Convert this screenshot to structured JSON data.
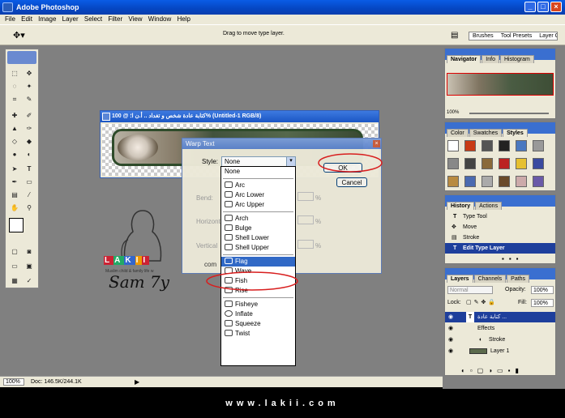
{
  "app": {
    "title": "Adobe Photoshop",
    "menu": [
      "File",
      "Edit",
      "Image",
      "Layer",
      "Select",
      "Filter",
      "View",
      "Window",
      "Help"
    ],
    "window_buttons": {
      "minimize": "_",
      "maximize": "□",
      "close": "×"
    }
  },
  "options_bar": {
    "hint": "Drag to move type layer.",
    "palette_tabs": [
      "Brushes",
      "Tool Presets",
      "Layer Comps"
    ]
  },
  "document": {
    "title": "كتابة عادة شخص و تغداد .. أ.ن ا؛ @ 100% (Untitled-1 RGB/8)"
  },
  "status": {
    "zoom": "100%",
    "doc": "Doc: 146.5K/244.1K"
  },
  "navigator": {
    "tabs": [
      "Navigator",
      "Info",
      "Histogram"
    ],
    "zoom": "100%"
  },
  "styles_panel": {
    "tabs": [
      "Color",
      "Swatches",
      "Styles"
    ]
  },
  "history_panel": {
    "tabs": [
      "History",
      "Actions"
    ],
    "items": [
      "Type Tool",
      "Move",
      "Stroke",
      "Edit Type Layer"
    ]
  },
  "layers_panel": {
    "tabs": [
      "Layers",
      "Channels",
      "Paths"
    ],
    "blend_mode": "Normal",
    "opacity_label": "Opacity:",
    "opacity": "100%",
    "lock_label": "Lock:",
    "fill_label": "Fill:",
    "fill": "100%",
    "layers": [
      "كتابة عادة ...",
      "Effects",
      "Stroke",
      "Layer 1"
    ]
  },
  "warp_dialog": {
    "title": "Warp Text",
    "style_label": "Style:",
    "style_value": "None",
    "ok": "OK",
    "cancel": "Cancel",
    "bend_label": "Bend:",
    "horizontal_label": "Horizontal",
    "vertical_label": "Vertical",
    "percent": "%",
    "options": [
      {
        "group": [
          "None"
        ]
      },
      {
        "group": [
          "Arc",
          "Arc Lower",
          "Arc Upper"
        ]
      },
      {
        "group": [
          "Arch",
          "Bulge",
          "Shell Lower",
          "Shell Upper"
        ]
      },
      {
        "group": [
          "Flag",
          "Wave",
          "Fish",
          "Rise"
        ]
      },
      {
        "group": [
          "Fisheye",
          "Inflate",
          "Squeeze",
          "Twist"
        ]
      }
    ],
    "selected": "Flag"
  },
  "watermark": {
    "letters": [
      "L",
      "A",
      "K",
      "I",
      "I"
    ],
    "tag": "com",
    "sub": "Muslim child & family life w",
    "signature": "Sam 7y"
  },
  "footer": {
    "url": "www.lakii.com"
  },
  "colors": {
    "xp_blue": "#0546c2",
    "highlight": "#3169c6",
    "annotation_red": "#d81e1e",
    "workspace": "#808080"
  }
}
